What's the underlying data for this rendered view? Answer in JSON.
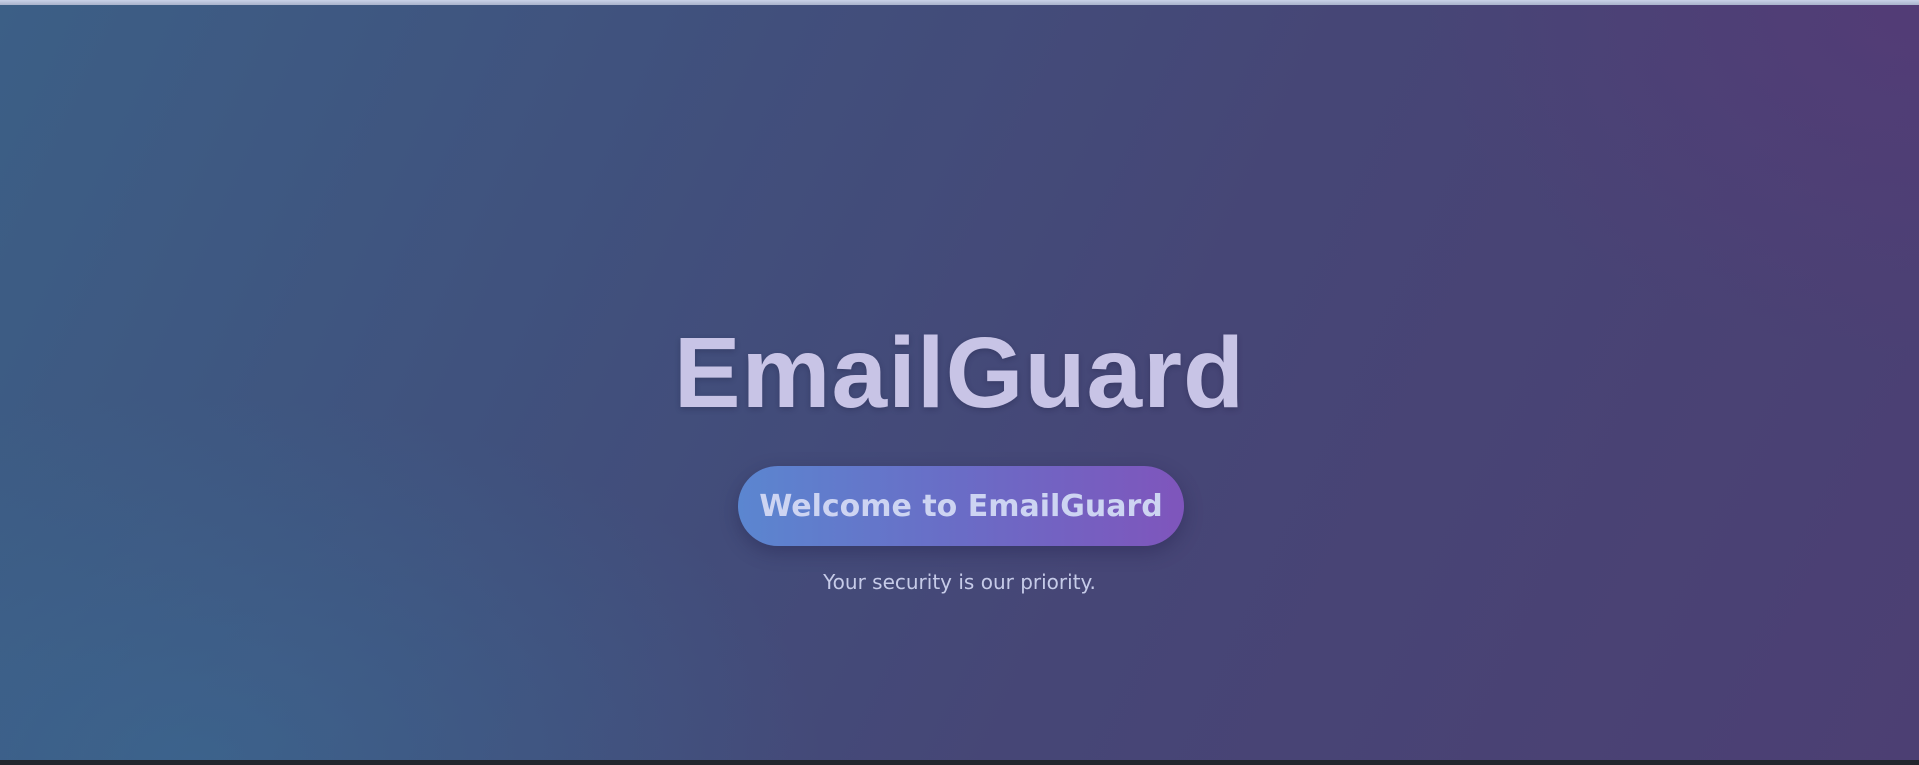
{
  "hero": {
    "title": "EmailGuard",
    "button_label": "Welcome to EmailGuard",
    "tagline": "Your security is our priority."
  },
  "colors": {
    "gradient_start": "#3c5f86",
    "gradient_end": "#4c3f73",
    "title_text": "#c8c4e6",
    "button_start": "#5b86d0",
    "button_end": "#7f55bc"
  }
}
